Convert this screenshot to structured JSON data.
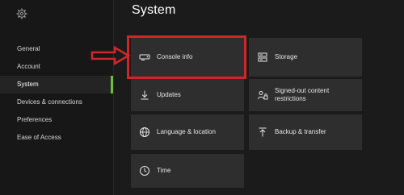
{
  "header": {
    "title": "System"
  },
  "sidebar": {
    "items": [
      {
        "label": "General"
      },
      {
        "label": "Account"
      },
      {
        "label": "System"
      },
      {
        "label": "Devices & connections"
      },
      {
        "label": "Preferences"
      },
      {
        "label": "Ease of Access"
      }
    ],
    "active_item": "System"
  },
  "tiles": {
    "console_info": {
      "label": "Console info",
      "icon": "console-icon"
    },
    "storage": {
      "label": "Storage",
      "icon": "storage-icon"
    },
    "updates": {
      "label": "Updates",
      "icon": "download-icon"
    },
    "signed_out": {
      "label": "Signed-out content restrictions",
      "icon": "users-lock-icon"
    },
    "language": {
      "label": "Language & location",
      "icon": "globe-icon"
    },
    "backup": {
      "label": "Backup & transfer",
      "icon": "upload-icon"
    },
    "time": {
      "label": "Time",
      "icon": "clock-icon"
    }
  },
  "colors": {
    "accent_green": "#6fbf3a",
    "highlight_red": "#d0262a",
    "tile_bg": "#2e2e2e",
    "page_bg": "#1b1b1b"
  }
}
